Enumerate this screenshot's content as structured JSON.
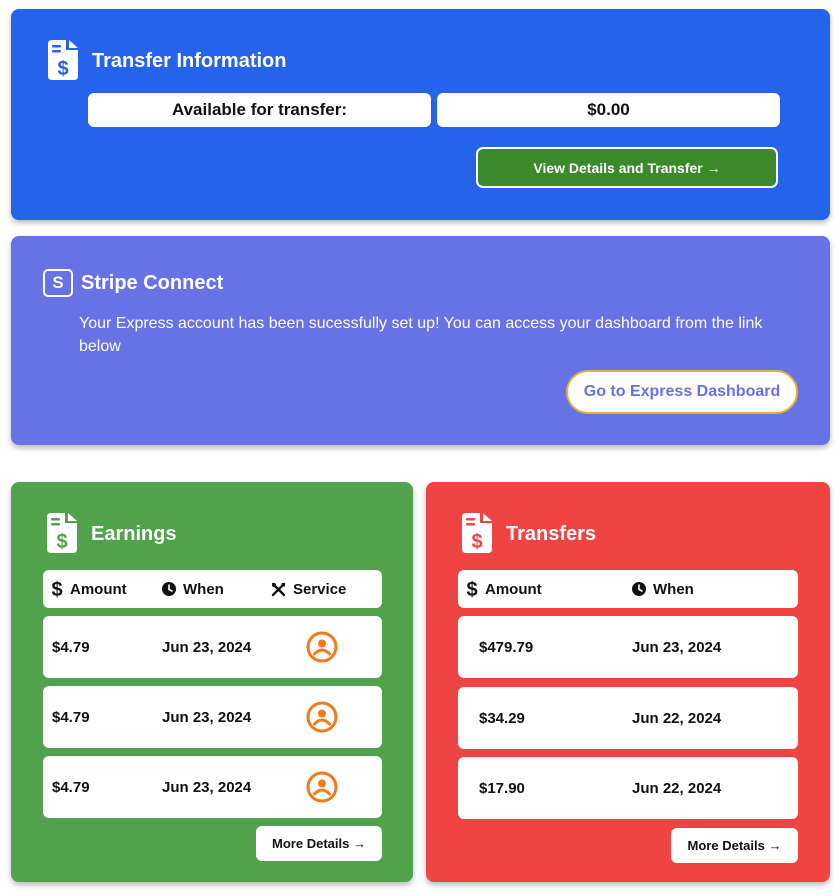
{
  "transfer_info": {
    "title": "Transfer Information",
    "available_label": "Available for transfer:",
    "available_value": "$0.00",
    "button_label": "View Details and Transfer →",
    "icon": "document-dollar-icon"
  },
  "stripe_connect": {
    "title": "Stripe Connect",
    "icon_letter": "S",
    "message": "Your Express account has been sucessfully set up! You can access your dashboard from the link below",
    "button_label": "Go to Express Dashboard",
    "button_border_color": "#e0b33a"
  },
  "earnings": {
    "title": "Earnings",
    "columns": [
      "Amount",
      "When",
      "Service"
    ],
    "rows": [
      {
        "amount": "$4.79",
        "when": "Jun 23, 2024",
        "service_icon": "user-circle-icon"
      },
      {
        "amount": "$4.79",
        "when": "Jun 23, 2024",
        "service_icon": "user-circle-icon"
      },
      {
        "amount": "$4.79",
        "when": "Jun 23, 2024",
        "service_icon": "user-circle-icon"
      }
    ],
    "more_label": "More Details →"
  },
  "transfers": {
    "title": "Transfers",
    "columns": [
      "Amount",
      "When"
    ],
    "rows": [
      {
        "amount": "$479.79",
        "when": "Jun 23, 2024"
      },
      {
        "amount": "$34.29",
        "when": "Jun 22, 2024"
      },
      {
        "amount": "$17.90",
        "when": "Jun 22, 2024"
      }
    ],
    "more_label": "More Details →"
  },
  "colors": {
    "transfer_info_bg": "#2563eb",
    "stripe_bg": "#6772e5",
    "earnings_bg": "#52a14c",
    "transfers_bg": "#ef4444",
    "button_green": "#3a8a2c",
    "service_icon_color": "#f07a1e"
  }
}
